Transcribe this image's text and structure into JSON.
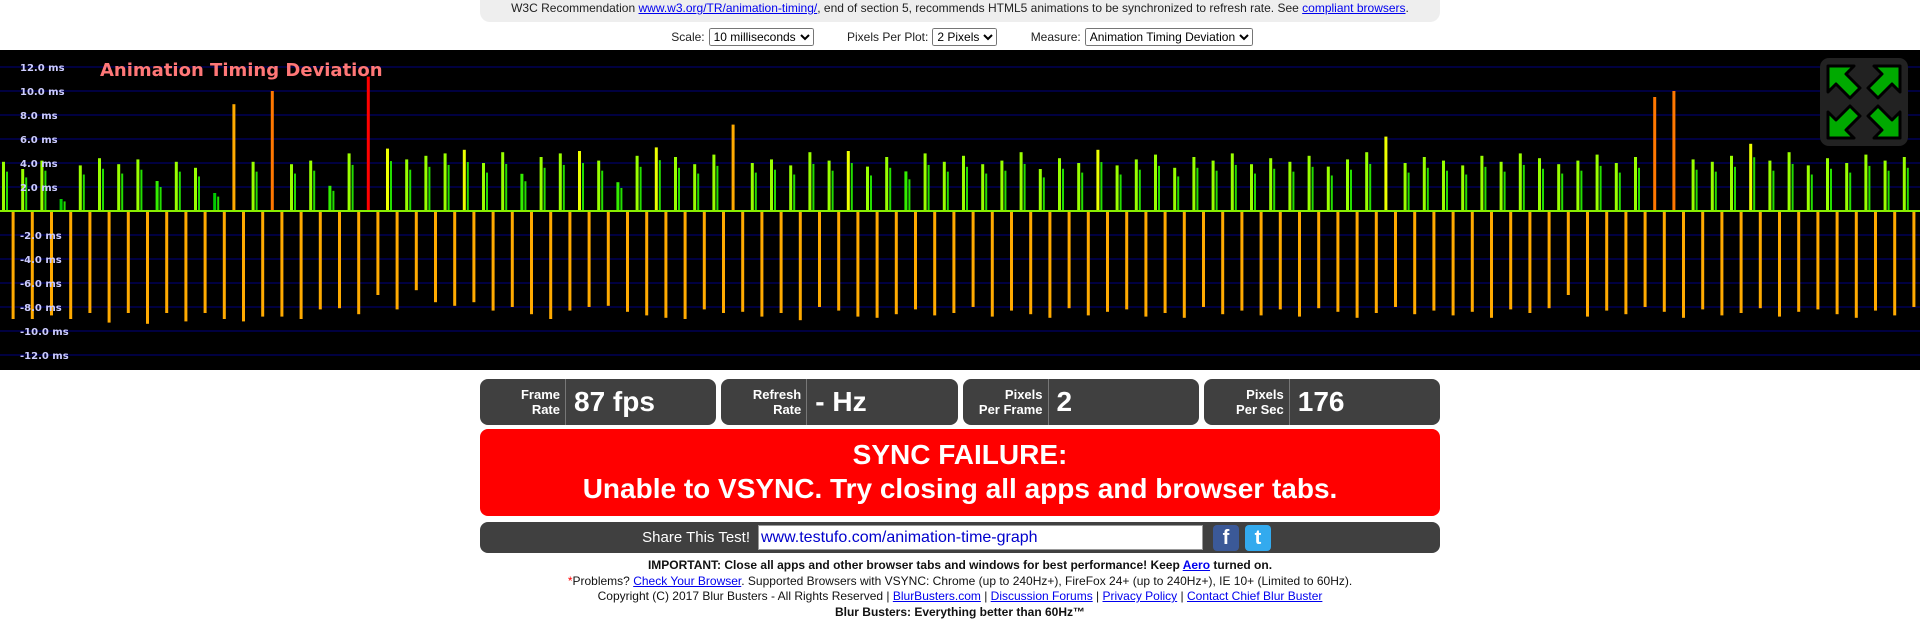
{
  "banner": {
    "prefix": "W3C Recommendation ",
    "link": "www.w3.org/TR/animation-timing/",
    "middle": ", end of section 5, recommends HTML5 animations to be synchronized to refresh rate. See ",
    "link2": "compliant browsers",
    "suffix": "."
  },
  "controls": {
    "scale_label": "Scale:",
    "scale_value": "10 milliseconds",
    "ppp_label": "Pixels Per Plot:",
    "ppp_value": "2 Pixels",
    "measure_label": "Measure:",
    "measure_value": "Animation Timing Deviation"
  },
  "chart_data": {
    "type": "bar",
    "title": "Animation Timing Deviation",
    "ylabel": "",
    "ylim": [
      -13,
      13
    ],
    "yticks": [
      12,
      10,
      8,
      6,
      4,
      2,
      -2,
      -4,
      -6,
      -8,
      -10,
      -12
    ],
    "ytick_labels": [
      "12.0 ms",
      "10.0 ms",
      "8.0 ms",
      "6.0 ms",
      "4.0 ms",
      "2.0 ms",
      "-2.0 ms",
      "-4.0 ms",
      "-6.0 ms",
      "-8.0 ms",
      "-10.0 ms",
      "-12.0 ms"
    ],
    "grid": true,
    "colors": {
      "grid": "#000080",
      "low": "#00cc00",
      "mid": "#99ff00",
      "high": "#eeff00",
      "late": "#ffaa00",
      "spike": "#ff7700",
      "fail": "#ff0000"
    },
    "values": [
      4.1,
      -9,
      3.5,
      -9,
      4.2,
      -8.7,
      1,
      -9,
      3.8,
      -8.5,
      4.4,
      -9.3,
      3.9,
      -8.5,
      4.3,
      -9.4,
      2.5,
      -8.5,
      4.1,
      -9.2,
      3.6,
      -8.5,
      1.5,
      -9,
      8.9,
      -9.2,
      4.1,
      -8.8,
      10,
      -8.8,
      3.9,
      -9,
      4.2,
      -8.2,
      2.1,
      -8.1,
      4.8,
      -8.6,
      11.2,
      -7.0,
      5.2,
      -8.2,
      4.3,
      -6.6,
      4.6,
      -7.6,
      4.8,
      -7.9,
      5.1,
      -7.6,
      4.0,
      -8.3,
      4.9,
      -8.0,
      3.1,
      -8.6,
      4.5,
      -9.0,
      4.8,
      -8.3,
      5.0,
      -8.0,
      4.2,
      -7.9,
      2.4,
      -8.4,
      4.6,
      -8.7,
      5.3,
      -8.9,
      4.5,
      -9.0,
      3.9,
      -8.2,
      4.7,
      -8.5,
      7.2,
      -8.4,
      4.0,
      -8.8,
      4.3,
      -8.5,
      3.8,
      -9.1,
      4.9,
      -8.0,
      4.2,
      -8.3,
      5.0,
      -8.8,
      3.7,
      -8.9,
      4.5,
      -8.6,
      3.3,
      -8.2,
      4.8,
      -8.7,
      4.1,
      -8.5,
      4.6,
      -8.0,
      3.9,
      -8.8,
      4.2,
      -8.3,
      4.9,
      -8.6,
      3.5,
      -8.9,
      4.4,
      -8.1,
      4.0,
      -8.7,
      5.1,
      -8.4,
      3.8,
      -8.2,
      4.3,
      -8.8,
      4.7,
      -8.5,
      3.6,
      -8.9,
      4.5,
      -8.0,
      4.2,
      -8.6,
      4.8,
      -8.3,
      3.9,
      -8.7,
      4.4,
      -8.2,
      4.1,
      -8.8,
      4.6,
      -8.1,
      3.7,
      -8.4,
      4.3,
      -8.9,
      4.9,
      -8.5,
      6.2,
      -8.0,
      4.0,
      -8.6,
      4.5,
      -8.3,
      4.2,
      -8.7,
      3.8,
      -8.4,
      4.6,
      -8.9,
      4.1,
      -8.2,
      4.8,
      -8.5,
      4.4,
      -8.1,
      3.9,
      -7.0,
      4.2,
      -8.8,
      4.7,
      -8.3,
      4.0,
      -8.6,
      4.5,
      -8.0,
      9.5,
      -8.4,
      10.0,
      -8.9,
      4.3,
      -8.2,
      4.1,
      -8.7,
      4.6,
      -8.5,
      5.6,
      -8.1,
      4.2,
      -8.8,
      4.9,
      -8.4,
      3.8,
      -8.2,
      4.4,
      -8.6,
      4.0,
      -8.9,
      4.7,
      -8.3,
      4.2,
      -8.7,
      4.5,
      -8.0
    ]
  },
  "fullscreen_icon": "expand-arrows-icon",
  "stats": [
    {
      "label1": "Frame",
      "label2": "Rate",
      "value": "87 fps"
    },
    {
      "label1": "Refresh",
      "label2": "Rate",
      "value": "- Hz"
    },
    {
      "label1": "Pixels",
      "label2": "Per Frame",
      "value": "2"
    },
    {
      "label1": "Pixels",
      "label2": "Per Sec",
      "value": "176"
    }
  ],
  "status": {
    "line1": "SYNC FAILURE:",
    "line2": "Unable to VSYNC. Try closing all apps and browser tabs.",
    "color": "#ff0000"
  },
  "share": {
    "label": "Share This Test!",
    "url": "www.testufo.com/animation-time-graph",
    "facebook": "f",
    "twitter": "t"
  },
  "footer": {
    "important": "IMPORTANT: Close all apps and other browser tabs and windows for best performance! Keep ",
    "aero": "Aero",
    "important_end": " turned on.",
    "star": "*",
    "problems": "Problems? ",
    "check": "Check Your Browser",
    "supported": ". Supported Browsers with VSYNC: Chrome (up to 240Hz+), FireFox 24+ (up to 240Hz+), IE 10+ (Limited to 60Hz).",
    "copyright": "Copyright (C) 2017 Blur Busters - All Rights Reserved | ",
    "links": [
      "BlurBusters.com",
      "Discussion Forums",
      "Privacy Policy",
      "Contact Chief Blur Buster"
    ],
    "tagline": "Blur Busters: Everything better than 60Hz™"
  }
}
